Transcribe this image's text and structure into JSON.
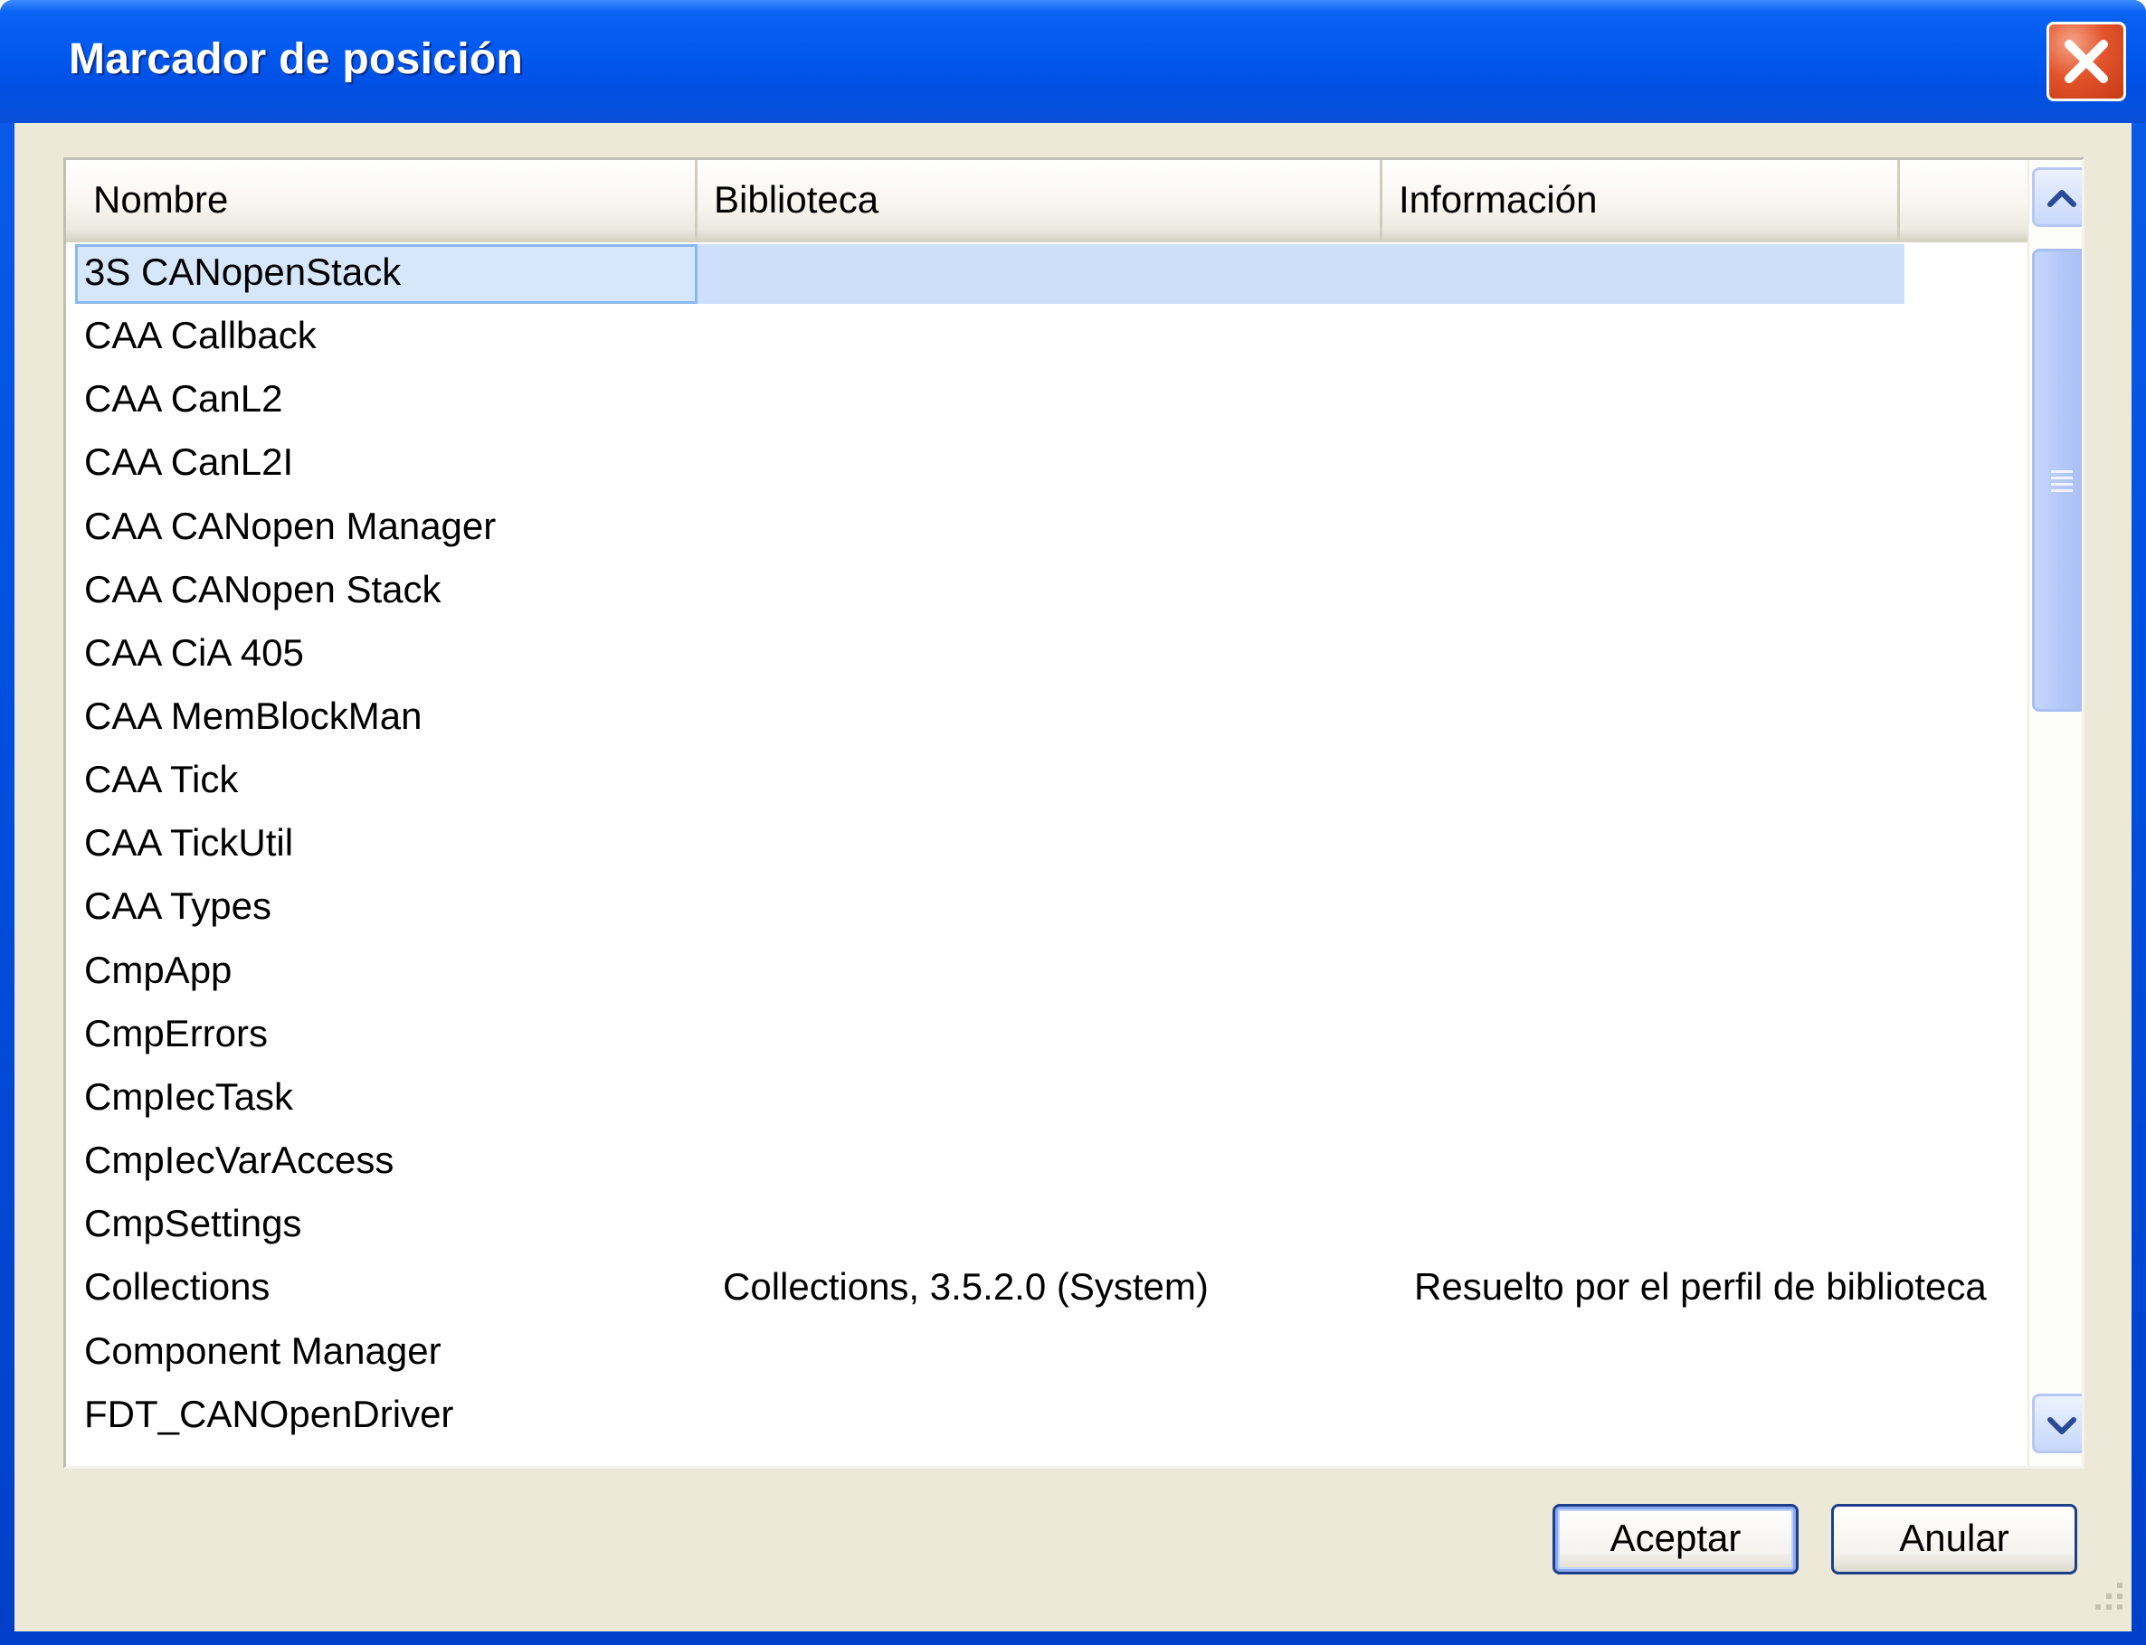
{
  "window": {
    "title": "Marcador de posición"
  },
  "table": {
    "columns": [
      "Nombre",
      "Biblioteca",
      "Información",
      ""
    ],
    "rows": [
      {
        "name": "3S CANopenStack",
        "library": "",
        "info": "",
        "selected": true
      },
      {
        "name": "CAA Callback",
        "library": "",
        "info": ""
      },
      {
        "name": "CAA CanL2",
        "library": "",
        "info": ""
      },
      {
        "name": "CAA CanL2I",
        "library": "",
        "info": ""
      },
      {
        "name": "CAA CANopen Manager",
        "library": "",
        "info": ""
      },
      {
        "name": "CAA CANopen Stack",
        "library": "",
        "info": ""
      },
      {
        "name": "CAA CiA 405",
        "library": "",
        "info": ""
      },
      {
        "name": "CAA MemBlockMan",
        "library": "",
        "info": ""
      },
      {
        "name": "CAA Tick",
        "library": "",
        "info": ""
      },
      {
        "name": "CAA TickUtil",
        "library": "",
        "info": ""
      },
      {
        "name": "CAA Types",
        "library": "",
        "info": ""
      },
      {
        "name": "CmpApp",
        "library": "",
        "info": ""
      },
      {
        "name": "CmpErrors",
        "library": "",
        "info": ""
      },
      {
        "name": "CmpIecTask",
        "library": "",
        "info": ""
      },
      {
        "name": "CmpIecVarAccess",
        "library": "",
        "info": ""
      },
      {
        "name": "CmpSettings",
        "library": "",
        "info": ""
      },
      {
        "name": "Collections",
        "library": "Collections, 3.5.2.0 (System)",
        "info": "Resuelto por el perfil de biblioteca"
      },
      {
        "name": "Component Manager",
        "library": "",
        "info": ""
      },
      {
        "name": "FDT_CANOpenDriver",
        "library": "",
        "info": ""
      }
    ]
  },
  "buttons": {
    "ok": "Aceptar",
    "cancel": "Anular"
  },
  "icons": {
    "close": "close-icon",
    "scroll_up": "chevron-up-icon",
    "scroll_down": "chevron-down-icon",
    "resize": "resize-grip-icon"
  },
  "colors": {
    "titlebar": "#0058ee",
    "selection": "#cde0fb",
    "dialog_bg": "#ece9d8",
    "close_button": "#e2542c"
  }
}
